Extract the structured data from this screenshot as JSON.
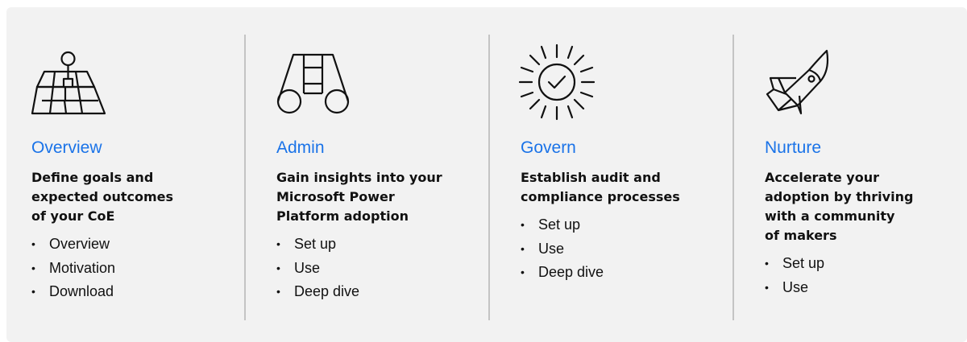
{
  "colors": {
    "panel_background": "#f2f2f2",
    "title_accent": "#1a73e8",
    "divider": "#c4c4c4",
    "text": "#111111"
  },
  "columns": [
    {
      "icon": "map-pin-icon",
      "title": "Overview",
      "description_lines": [
        "Define goals and",
        "expected outcomes",
        "of your CoE"
      ],
      "links": [
        "Overview",
        "Motivation",
        "Download"
      ]
    },
    {
      "icon": "binoculars-icon",
      "title": "Admin",
      "description_lines": [
        "Gain insights into your",
        "Microsoft Power",
        "Platform adoption"
      ],
      "links": [
        "Set up",
        "Use",
        "Deep dive"
      ]
    },
    {
      "icon": "sun-check-icon",
      "title": "Govern",
      "description_lines": [
        "Establish audit and",
        "compliance processes"
      ],
      "links": [
        "Set up",
        "Use",
        "Deep dive"
      ]
    },
    {
      "icon": "rocket-icon",
      "title": "Nurture",
      "description_lines": [
        "Accelerate your",
        "adoption by thriving",
        "with a community",
        "of makers"
      ],
      "links": [
        "Set up",
        "Use"
      ]
    }
  ]
}
